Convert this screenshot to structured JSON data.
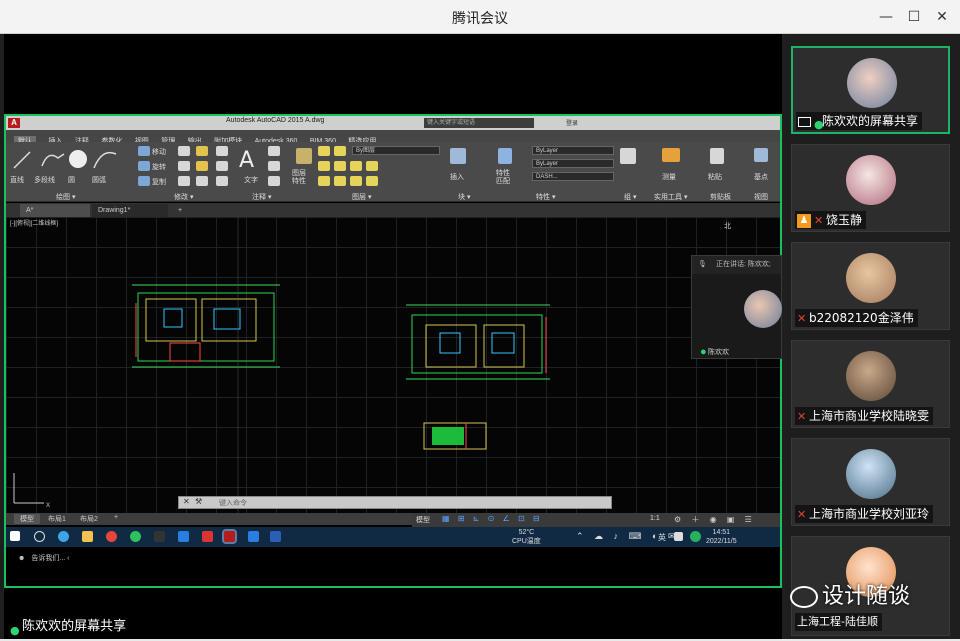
{
  "window": {
    "title": "腾讯会议",
    "minimize": "—",
    "maximize": "☐",
    "close": "✕"
  },
  "cad": {
    "app_title": "Autodesk AutoCAD 2015   A.dwg",
    "search_placeholder": "键入关键字或短语",
    "login": "登录",
    "menu": [
      "默认",
      "插入",
      "注释",
      "参数化",
      "视图",
      "管理",
      "输出",
      "附加模块",
      "Autodesk 360",
      "BIM 360",
      "精选应用"
    ],
    "ribbon": {
      "draw_tools": [
        "直线",
        "多段线",
        "圆",
        "圆弧"
      ],
      "draw_group": "绘图 ▾",
      "modify_tools": [
        "移动",
        "旋转",
        "复制",
        "镜像",
        "拉伸",
        "缩放"
      ],
      "modify_group": "修改 ▾",
      "annot_big": "A",
      "annot_text": "文字",
      "annot_group": "注释 ▾",
      "layer_props": "图层特性",
      "layer_group": "图层 ▾",
      "layer_combo": "By图层",
      "insert": "插入",
      "block_group": "块 ▾",
      "match_props": "特性匹配",
      "bylayer1": "ByLayer",
      "bylayer2": "ByLayer",
      "dash": "DASH...",
      "props_group": "特性 ▾",
      "group_group": "组 ▾",
      "measure": "测量",
      "util_group": "实用工具 ▾",
      "paste": "粘贴",
      "clip_group": "剪贴板",
      "base_point": "基点",
      "view_group": "视图"
    },
    "doc_tabs": [
      "A*",
      "Drawing1*",
      "+"
    ],
    "viewport_label": "[-][俯视][二维线框]",
    "viewcube": "北",
    "assistant": "告诉我们...",
    "cmd_placeholder": "键入命令",
    "layout_tabs": [
      "模型",
      "布局1",
      "布局2",
      "+"
    ],
    "status_model": "模型",
    "scale": "1:1",
    "taskbar": {
      "temp": "52°C",
      "temp_label": "CPU温度",
      "ime": "英",
      "time": "14:51",
      "date": "2022/11/5"
    }
  },
  "speaker": {
    "head": "正在讲话: 陈欢欢;",
    "name": "陈欢欢"
  },
  "participants": [
    {
      "name": "陈欢欢的屏幕共享",
      "state": "sharing"
    },
    {
      "name": "饶玉静",
      "state": "host-muted"
    },
    {
      "name": "b22082120金泽伟",
      "state": "muted"
    },
    {
      "name": "上海市商业学校陆晓雯",
      "state": "muted"
    },
    {
      "name": "上海市商业学校刘亚玲",
      "state": "muted"
    },
    {
      "name": "上海工程-陆佳顺",
      "state": "none"
    }
  ],
  "bottom_share_label": "陈欢欢的屏幕共享",
  "watermark": "设计随谈",
  "colors": {
    "accent_green": "#1fb36a",
    "muted_red": "#e0443a",
    "host_orange": "#f39a1e",
    "cad_green": "#16c35e"
  }
}
